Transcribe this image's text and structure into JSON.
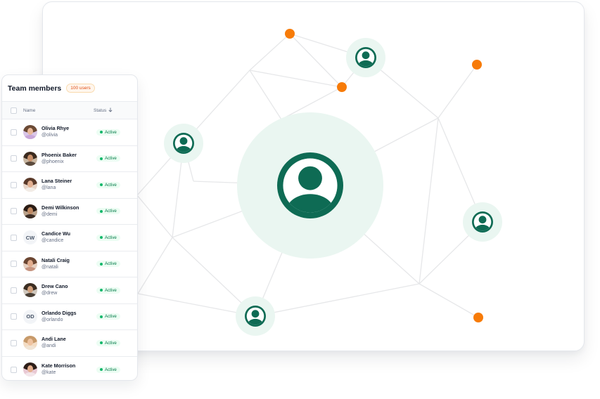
{
  "team_panel": {
    "title": "Team members",
    "count_badge": "100 users",
    "columns": {
      "name": "Name",
      "status": "Status",
      "sort_icon": "arrow-down-icon"
    },
    "members": [
      {
        "name": "Olivia Rhye",
        "handle": "@olivia",
        "status": "Active",
        "avatar": "photo"
      },
      {
        "name": "Phoenix Baker",
        "handle": "@phoenix",
        "status": "Active",
        "avatar": "photo"
      },
      {
        "name": "Lana Steiner",
        "handle": "@lana",
        "status": "Active",
        "avatar": "photo"
      },
      {
        "name": "Demi Wilkinson",
        "handle": "@demi",
        "status": "Active",
        "avatar": "photo"
      },
      {
        "name": "Candice Wu",
        "handle": "@candice",
        "status": "Active",
        "avatar": "initials",
        "initials": "CW"
      },
      {
        "name": "Natali Craig",
        "handle": "@natali",
        "status": "Active",
        "avatar": "photo"
      },
      {
        "name": "Drew Cano",
        "handle": "@drew",
        "status": "Active",
        "avatar": "photo"
      },
      {
        "name": "Orlando Diggs",
        "handle": "@orlando",
        "status": "Active",
        "avatar": "initials",
        "initials": "OD"
      },
      {
        "name": "Andi Lane",
        "handle": "@andi",
        "status": "Active",
        "avatar": "photo"
      },
      {
        "name": "Kate Morrison",
        "handle": "@kate",
        "status": "Active",
        "avatar": "photo"
      }
    ]
  },
  "network": {
    "node_icon": "user-circle-icon",
    "colors": {
      "node_fill": "#eaf6f1",
      "icon": "#0e6b54",
      "accent_dot": "#f77b08",
      "edge": "#e6e7e9",
      "status_green": "#12b76a"
    }
  }
}
